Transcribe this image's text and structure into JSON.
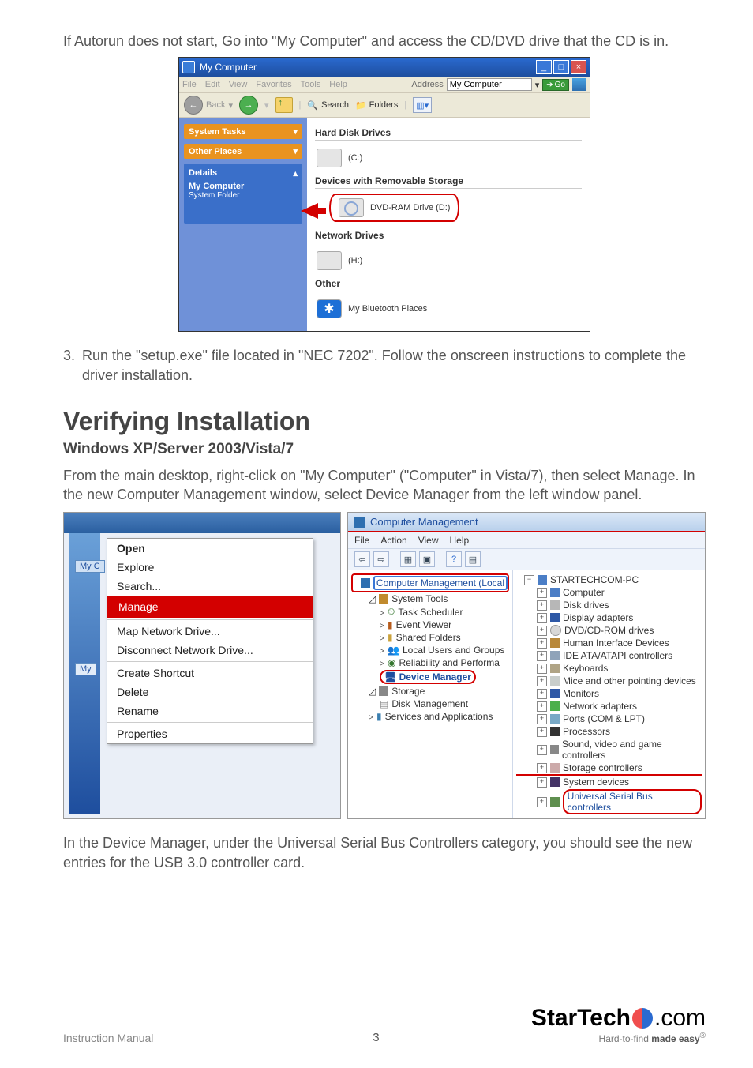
{
  "intro_text": "If Autorun does not start, Go into \"My Computer\" and access the CD/DVD drive that the CD is in.",
  "mycomputer": {
    "title": "My Computer",
    "menu": {
      "file": "File",
      "edit": "Edit",
      "view": "View",
      "favorites": "Favorites",
      "tools": "Tools",
      "help": "Help"
    },
    "address_label": "Address",
    "address_value": "My Computer",
    "go": "Go",
    "toolbar": {
      "back": "Back",
      "search": "Search",
      "folders": "Folders"
    },
    "side": {
      "system_tasks": "System Tasks",
      "other_places": "Other Places",
      "details": "Details",
      "details_title": "My Computer",
      "details_sub": "System Folder"
    },
    "cat_hdd": "Hard Disk Drives",
    "drive_c": "(C:)",
    "cat_rem": "Devices with Removable Storage",
    "drive_dvd": "DVD-RAM Drive (D:)",
    "cat_net": "Network Drives",
    "drive_h": "(H:)",
    "cat_other": "Other",
    "bt_places": "My Bluetooth Places"
  },
  "step3": {
    "num": "3.",
    "text": "Run the \"setup.exe\" file located in \"NEC 7202\".  Follow the onscreen instructions to complete the driver installation."
  },
  "heading_verify": "Verifying Installation",
  "subheading": "Windows XP/Server 2003/Vista/7",
  "verify_text": "From the main desktop, right-click on \"My Computer\" (\"Computer\" in Vista/7), then select Manage. In the new Computer Management window, select Device Manager from the left window panel.",
  "context_menu": {
    "myc_label": "My C",
    "myp_label": "My",
    "open": "Open",
    "explore": "Explore",
    "search": "Search...",
    "manage": "Manage",
    "map": "Map Network Drive...",
    "disconnect": "Disconnect Network Drive...",
    "shortcut": "Create Shortcut",
    "delete": "Delete",
    "rename": "Rename",
    "properties": "Properties"
  },
  "comp_mgmt": {
    "title": "Computer Management",
    "menu": {
      "file": "File",
      "action": "Action",
      "view": "View",
      "help": "Help"
    },
    "tree": {
      "root": "Computer Management (Local",
      "sys_tools": "System Tools",
      "task_sched": "Task Scheduler",
      "event_viewer": "Event Viewer",
      "shared": "Shared Folders",
      "local_users": "Local Users and Groups",
      "reliability": "Reliability and Performa",
      "dev_mgr": "Device Manager",
      "storage": "Storage",
      "disk_mgmt": "Disk Management",
      "services": "Services and Applications"
    },
    "devices": {
      "root": "STARTECHCOM-PC",
      "computer": "Computer",
      "disk": "Disk drives",
      "display": "Display adapters",
      "dvd": "DVD/CD-ROM drives",
      "hid": "Human Interface Devices",
      "ide": "IDE ATA/ATAPI controllers",
      "kbd": "Keyboards",
      "mouse": "Mice and other pointing devices",
      "mon": "Monitors",
      "net": "Network adapters",
      "ports": "Ports (COM & LPT)",
      "proc": "Processors",
      "sound": "Sound, video and game controllers",
      "storage": "Storage controllers",
      "sysdev": "System devices",
      "usb": "Universal Serial Bus controllers"
    }
  },
  "final_text": "In the Device Manager, under the Universal Serial Bus Controllers category, you should see the new entries for the USB 3.0 controller card.",
  "footer": {
    "manual": "Instruction Manual",
    "page": "3",
    "brand1": "Star",
    "brand2": "Tech",
    "brand3": ".com",
    "tagline_a": "Hard-to-find ",
    "tagline_b": "made easy",
    "reg": "®"
  }
}
